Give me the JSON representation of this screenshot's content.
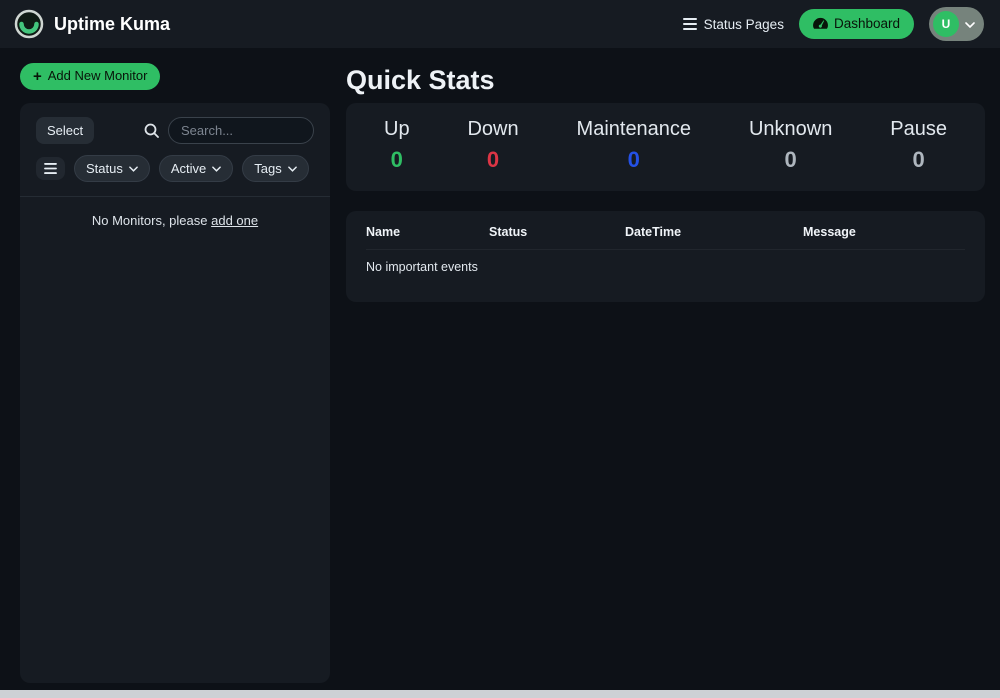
{
  "header": {
    "app_title": "Uptime Kuma",
    "status_pages_label": "Status Pages",
    "dashboard_label": "Dashboard",
    "user_initial": "U"
  },
  "sidebar": {
    "add_monitor_label": "Add New Monitor",
    "select_label": "Select",
    "search_placeholder": "Search...",
    "filters": {
      "status": "Status",
      "active": "Active",
      "tags": "Tags"
    },
    "empty_text": "No Monitors, please",
    "empty_link_label": "add one"
  },
  "main": {
    "title": "Quick Stats",
    "stats": [
      {
        "label": "Up",
        "value": "0",
        "color": "#2fbe64"
      },
      {
        "label": "Down",
        "value": "0",
        "color": "#dc3545"
      },
      {
        "label": "Maintenance",
        "value": "0",
        "color": "#2451e6"
      },
      {
        "label": "Unknown",
        "value": "0",
        "color": "#aeb6be"
      },
      {
        "label": "Pause",
        "value": "0",
        "color": "#aeb6be"
      }
    ],
    "events_table": {
      "headers": [
        "Name",
        "Status",
        "DateTime",
        "Message"
      ],
      "empty_text": "No important events"
    }
  },
  "icons": {
    "plus_glyph": "+",
    "logo": "uptime-kuma-logo",
    "status_pages": "list-icon",
    "dashboard": "gauge-icon",
    "user_menu": "chevron-down-icon",
    "search": "search-icon",
    "filter_menu": "hamburger-icon"
  },
  "colors": {
    "background": "#0d1117",
    "header_background": "#161b22",
    "card_background": "#161b22",
    "accent_green": "#2fbe64",
    "up": "#2fbe64",
    "down": "#dc3545",
    "maintenance": "#2451e6",
    "unknown": "#aeb6be",
    "pause": "#aeb6be"
  }
}
